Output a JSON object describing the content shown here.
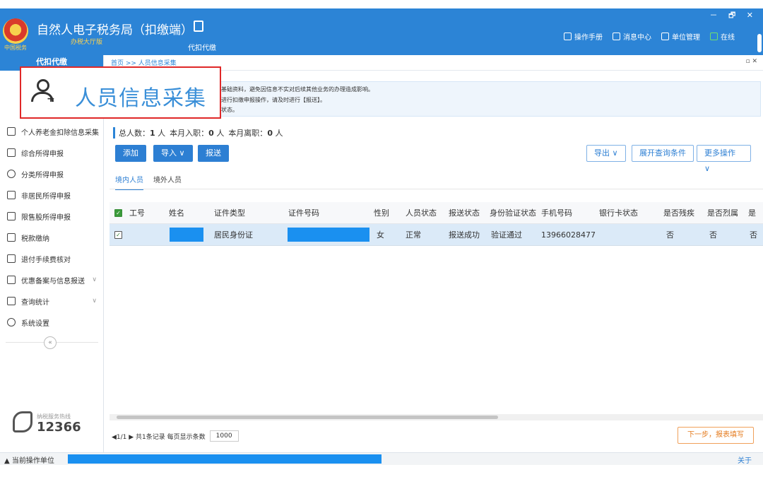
{
  "app": {
    "title": "自然人电子税务局（扣缴端）",
    "subtitle": "办税大厅版",
    "emblem_caption": "中国税务",
    "module_label": "代扣代缴",
    "window_controls": "－ 🗗 ✕"
  },
  "topnav": [
    {
      "label": "操作手册",
      "icon": "manual-icon"
    },
    {
      "label": "消息中心",
      "icon": "mail-icon"
    },
    {
      "label": "单位管理",
      "icon": "building-icon"
    },
    {
      "label": "在线",
      "icon": "online-icon",
      "color": "#6fe06f"
    }
  ],
  "sidebar": {
    "header": "代扣代缴",
    "items": [
      {
        "label": "个人养老金扣除信息采集",
        "icon": "pension-icon"
      },
      {
        "label": "综合所得申报",
        "icon": "layers-icon"
      },
      {
        "label": "分类所得申报",
        "icon": "clock-icon"
      },
      {
        "label": "非居民所得申报",
        "icon": "person-icon"
      },
      {
        "label": "限售股所得申报",
        "icon": "bars-icon"
      },
      {
        "label": "税款缴纳",
        "icon": "folder-icon"
      },
      {
        "label": "退付手续费核对",
        "icon": "list-icon"
      },
      {
        "label": "优惠备案与信息报送",
        "icon": "doc-icon",
        "expandable": true
      },
      {
        "label": "查询统计",
        "icon": "query-icon",
        "expandable": true
      },
      {
        "label": "系统设置",
        "icon": "gear-icon"
      }
    ],
    "collapse_label": "«",
    "hotline_label": "纳税服务热线",
    "hotline_number": "12366"
  },
  "breadcrumb": {
    "text": "首页 >> 人员信息采集",
    "close": "▫ ✕"
  },
  "notice": [
    "基础资料，避免因信息不实对后续其他业务的办理造成影响。",
    "进行扣缴申报操作，请及时进行【报送】。",
    "状态。"
  ],
  "highlight": {
    "title": "人员信息采集"
  },
  "stats": {
    "total_label": "总人数：",
    "total": "1",
    "total_unit": "人",
    "joined_label": "本月入职：",
    "joined": "0",
    "joined_unit": "人",
    "left_label": "本月离职：",
    "left": "0",
    "left_unit": "人"
  },
  "toolbar": {
    "add": "添加",
    "import": "导入 ∨",
    "submit": "报送",
    "export": "导出 ∨",
    "expand_query": "展开查询条件",
    "more": "更多操作 ∨"
  },
  "tabs": [
    "境内人员",
    "境外人员"
  ],
  "table": {
    "columns": [
      "工号",
      "姓名",
      "证件类型",
      "证件号码",
      "性别",
      "人员状态",
      "报送状态",
      "身份验证状态",
      "手机号码",
      "银行卡状态",
      "是否残疾",
      "是否烈属",
      "是"
    ],
    "rows": [
      {
        "id_no": "",
        "name": "",
        "id_type": "居民身份证",
        "id_number": "",
        "gender": "女",
        "person_status": "正常",
        "submit_status": "报送成功",
        "verify_status": "验证通过",
        "phone": "13966028477",
        "bank_status": "",
        "disabled": "否",
        "martyr": "否",
        "more": "否"
      }
    ]
  },
  "pager": {
    "text": "◀1/1 ▶ 共1条记录 每页显示条数",
    "page_size": "1000"
  },
  "next_button": "下一步，报表填写",
  "statusbar": {
    "label": "当前操作单位",
    "about": "关于"
  }
}
